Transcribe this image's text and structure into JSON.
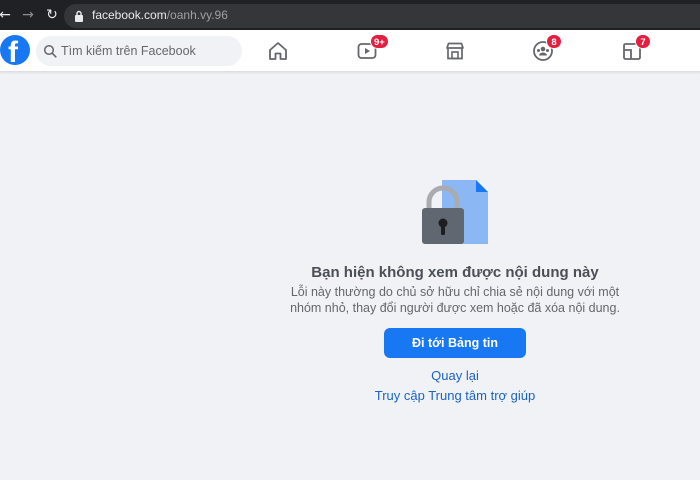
{
  "browser": {
    "url_host": "facebook.com",
    "url_path": "/oanh.vy.96"
  },
  "header": {
    "logo_letter": "f",
    "search_placeholder": "Tìm kiếm trên Facebook",
    "nav": [
      {
        "name": "home-icon"
      },
      {
        "name": "watch-icon",
        "badge": "9+"
      },
      {
        "name": "marketplace-icon"
      },
      {
        "name": "groups-icon",
        "badge": "8"
      },
      {
        "name": "gaming-icon",
        "badge": "7"
      }
    ]
  },
  "content": {
    "title": "Bạn hiện không xem được nội dung này",
    "description_line1": "Lỗi này thường do chủ sở hữu chỉ chia sẻ nội dung với một",
    "description_line2": "nhóm nhỏ, thay đổi người được xem hoặc đã xóa nội dung.",
    "primary_button": "Đi tới Bảng tin",
    "back_link": "Quay lại",
    "help_link": "Truy cập Trung tâm trợ giúp"
  },
  "colors": {
    "brand": "#1877f2",
    "badge": "#e41e3f",
    "link": "#1b63c9"
  }
}
